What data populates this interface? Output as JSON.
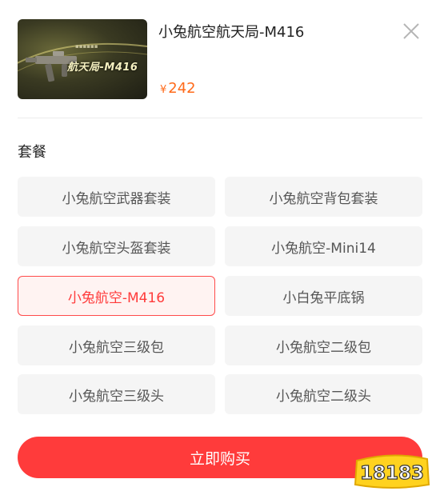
{
  "product": {
    "title": "小兔航空航天局-M416",
    "image_caption": "航天局-M416",
    "currency_symbol": "¥",
    "price": "242"
  },
  "section": {
    "label": "套餐"
  },
  "options": [
    {
      "label": "小兔航空武器套装",
      "selected": false
    },
    {
      "label": "小兔航空背包套装",
      "selected": false
    },
    {
      "label": "小兔航空头盔套装",
      "selected": false
    },
    {
      "label": "小兔航空-Mini14",
      "selected": false
    },
    {
      "label": "小兔航空-M416",
      "selected": true
    },
    {
      "label": "小白兔平底锅",
      "selected": false
    },
    {
      "label": "小兔航空三级包",
      "selected": false
    },
    {
      "label": "小兔航空二级包",
      "selected": false
    },
    {
      "label": "小兔航空三级头",
      "selected": false
    },
    {
      "label": "小兔航空二级头",
      "selected": false
    }
  ],
  "buy_button": {
    "label": "立即购买"
  },
  "watermark": {
    "text": "18183"
  },
  "colors": {
    "accent": "#ff3b3b",
    "price": "#ff6a1a",
    "option_bg": "#f5f5f5",
    "selected_bg": "#fff3f2"
  }
}
